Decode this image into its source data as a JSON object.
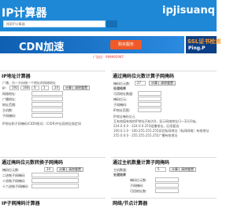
{
  "header": {
    "logo": "IP计算器",
    "site": "ipjisuanq",
    "search_placeholder": "搜索IP计算器"
  },
  "banner": {
    "cdn_title": "CDN加速",
    "cdn_button": "购买服务",
    "ssl_line1": "SSL证书检测",
    "ssl_line2": "Ping.P"
  },
  "ad_text": "广告位：999995997",
  "left_panel": {
    "title": "IP地址计算器",
    "desc": "广播，另一方向统一个地址的网络地址",
    "ip_label": "IP:",
    "ip": [
      "192",
      "168",
      "0",
      "1"
    ],
    "mask": "24",
    "calc_button": "计算",
    "clear_button": "清除重置",
    "rows": [
      "网络地址:",
      "广播地址:",
      "地址范围:",
      "主机数:",
      "子网掩码:"
    ],
    "note": "IP地址和子网掩码(CIDR格式)（CIDR)中出现地址指定如"
  },
  "right_panel": {
    "title": "通过掩码位元数计算子网掩码",
    "mask_bits_label": "掩码位元数:",
    "mask_bits": "27",
    "calc_button": "计算",
    "clear_button": "清除重置",
    "result_label": "处理结果",
    "rows": [
      "可用地址数量:",
      "掩码位元:",
      "子网掩码:",
      "IP地址范围:"
    ],
    "notes": [
      "IP地址掩码位元",
      "互有效值有效的IP地址开始为0，显示网络地址(1~32)开始。",
      "224.0.0.0 - 224.0.0.255组播地址，后续要选",
      "100.0.1.0 - 100.255.255.255实验私网地址（私网网络）有效地址",
      "255.0.0.0 - 255.255.255.255广播有效地址"
    ]
  },
  "left_panel2": {
    "title": "通过掩码位元数转换子网掩码",
    "mask_bits_label": "掩码位元数:",
    "mask_bits": "24",
    "calc_button": "计算",
    "clear_button": "清除重置",
    "rows": [
      "二进制子网掩码:",
      "十进制子网掩码:",
      "十六进制子网掩码:"
    ]
  },
  "right_panel2": {
    "title": "通过主机数量计算子网掩码",
    "hosts_label": "主机数量:",
    "hosts": "5",
    "calc_button": "计算",
    "clear_button": "清除重置",
    "result_label": "处理结果",
    "rows": [
      "掩码位元数:",
      "子网掩码:",
      "可用地址数:"
    ]
  },
  "bottom": {
    "left_title": "IP子网掩码计算器",
    "right_title": "网络/节点计算器"
  }
}
